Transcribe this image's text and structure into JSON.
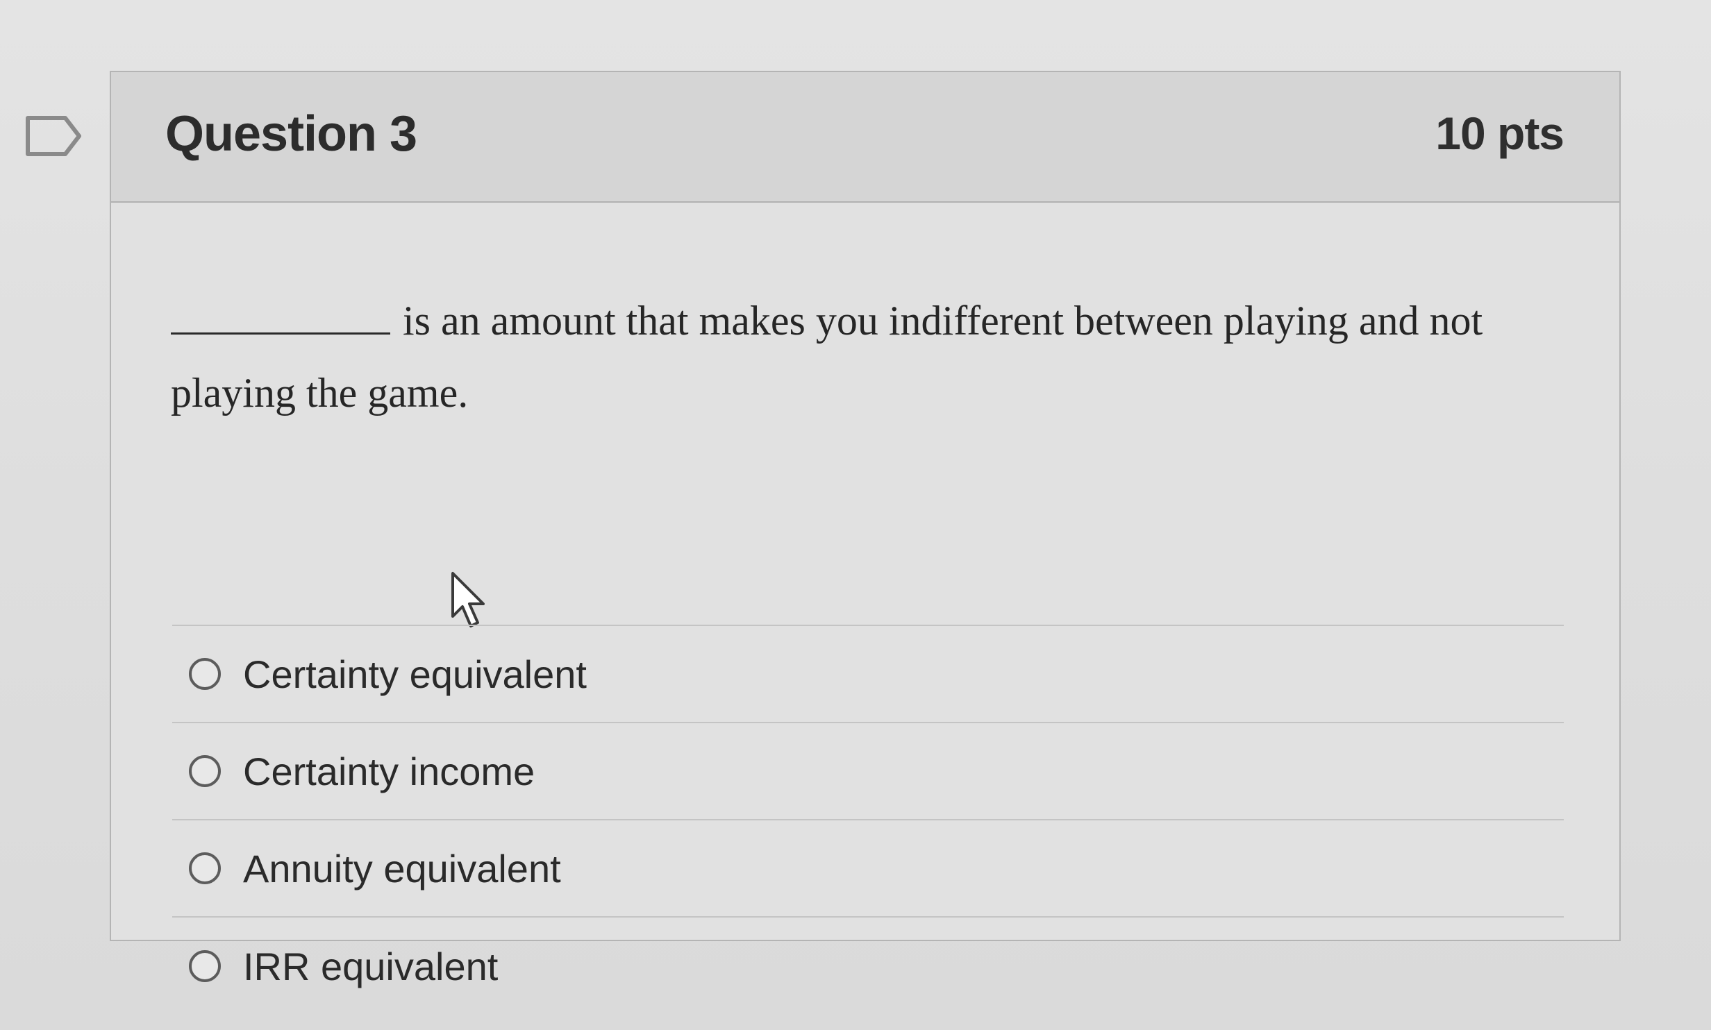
{
  "question": {
    "title": "Question 3",
    "points": "10 pts",
    "prompt_text": "is an amount that makes you indifferent between playing and not playing the game."
  },
  "answers": [
    {
      "label": "Certainty equivalent",
      "selected": false
    },
    {
      "label": "Certainty income",
      "selected": false
    },
    {
      "label": "Annuity equivalent",
      "selected": false
    },
    {
      "label": "IRR equivalent",
      "selected": false
    }
  ],
  "icons": {
    "flag": "flag-icon",
    "cursor": "mouse-cursor-icon",
    "radio": "radio-button-icon"
  }
}
